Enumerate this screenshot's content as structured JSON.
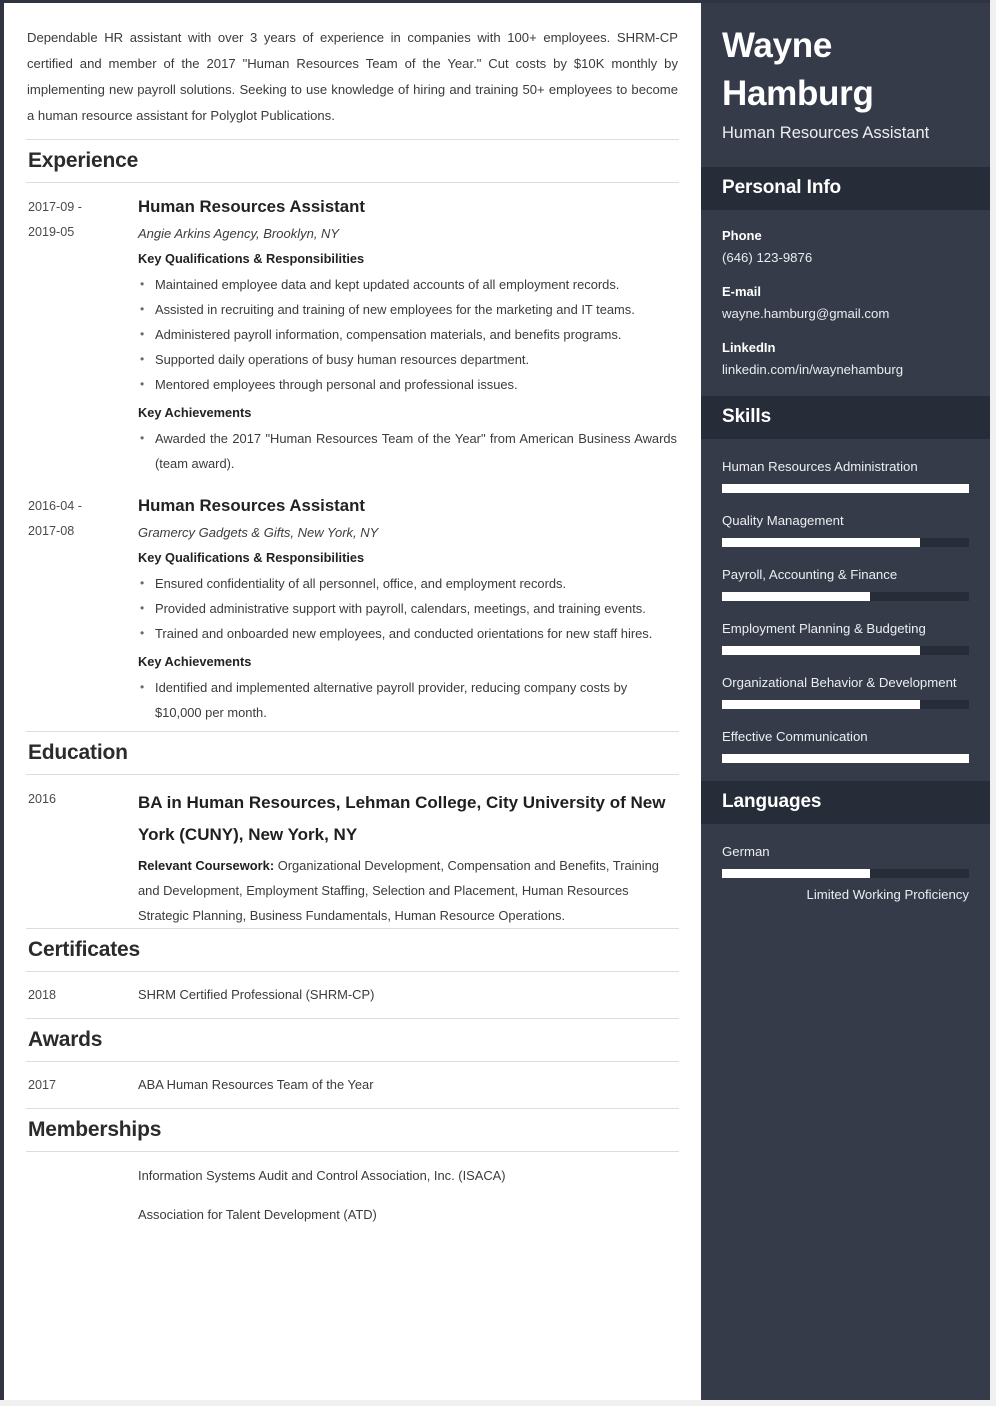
{
  "resume": {
    "summary": "Dependable HR assistant with over 3 years of experience in companies with 100+ employees. SHRM-CP certified and member of the 2017 \"Human Resources Team of the Year.\" Cut costs by $10K monthly by implementing new payroll solutions. Seeking to use knowledge of hiring and training 50+ employees to become a human resource assistant for Polyglot Publications.",
    "sections": {
      "experience": "Experience",
      "education": "Education",
      "certificates": "Certificates",
      "awards": "Awards",
      "memberships": "Memberships"
    },
    "experience": [
      {
        "date_start": "2017-09 -",
        "date_end": "2019-05",
        "title": "Human Resources Assistant",
        "company": "Angie Arkins Agency, Brooklyn, NY",
        "qualifications_heading": "Key Qualifications & Responsibilities",
        "qualifications": [
          "Maintained employee data and kept updated accounts of all employment records.",
          "Assisted in recruiting and training of new employees for the marketing and IT teams.",
          "Administered payroll information, compensation materials, and benefits programs.",
          "Supported daily operations of busy human resources department.",
          "Mentored employees through personal and professional issues."
        ],
        "achievements_heading": "Key Achievements",
        "achievements": [
          "Awarded the 2017 \"Human Resources Team of the Year\" from American Business Awards (team award)."
        ]
      },
      {
        "date_start": "2016-04 -",
        "date_end": "2017-08",
        "title": "Human Resources Assistant",
        "company": "Gramercy Gadgets & Gifts, New York, NY",
        "qualifications_heading": "Key Qualifications & Responsibilities",
        "qualifications": [
          "Ensured confidentiality of all personnel, office, and employment records.",
          "Provided administrative support with payroll, calendars, meetings, and training events.",
          "Trained and onboarded new employees, and conducted orientations for new staff hires."
        ],
        "achievements_heading": "Key Achievements",
        "achievements": [
          "Identified and implemented alternative payroll provider, reducing company costs by $10,000 per month."
        ]
      }
    ],
    "education": {
      "date": "2016",
      "title": "BA in Human Resources, Lehman College, City University of New York (CUNY), New York, NY",
      "coursework_label": "Relevant Coursework:",
      "coursework": " Organizational Development, Compensation and Benefits, Training and Development, Employment Staffing, Selection and Placement, Human Resources Strategic Planning, Business Fundamentals, Human Resource Operations."
    },
    "certificates": [
      {
        "date": "2018",
        "text": "SHRM Certified Professional (SHRM-CP)"
      }
    ],
    "awards": [
      {
        "date": "2017",
        "text": "ABA Human Resources Team of the Year"
      }
    ],
    "memberships": [
      {
        "text": "Information Systems Audit and Control Association, Inc. (ISACA)"
      },
      {
        "text": "Association for Talent Development (ATD)"
      }
    ]
  },
  "sidebar": {
    "name": "Wayne Hamburg",
    "role": "Human Resources Assistant",
    "personal_info_heading": "Personal Info",
    "contacts": [
      {
        "label": "Phone",
        "value": "(646) 123-9876"
      },
      {
        "label": "E-mail",
        "value": "wayne.hamburg@gmail.com"
      },
      {
        "label": "LinkedIn",
        "value": "linkedin.com/in/waynehamburg"
      }
    ],
    "skills_heading": "Skills",
    "skills": [
      {
        "name": "Human Resources Administration",
        "level": 100
      },
      {
        "name": "Quality Management",
        "level": 80
      },
      {
        "name": "Payroll, Accounting & Finance",
        "level": 60
      },
      {
        "name": "Employment Planning & Budgeting",
        "level": 80
      },
      {
        "name": "Organizational Behavior & Development",
        "level": 80
      },
      {
        "name": "Effective Communication",
        "level": 100
      }
    ],
    "languages_heading": "Languages",
    "languages": [
      {
        "name": "German",
        "level": 60,
        "proficiency": "Limited Working Proficiency"
      }
    ]
  },
  "colors": {
    "sidebar_bg": "#353b48",
    "sidebar_header_bg": "#262c38",
    "bar_fill": "#ffffff",
    "page_bg": "#ffffff",
    "rule": "#dddddd"
  }
}
